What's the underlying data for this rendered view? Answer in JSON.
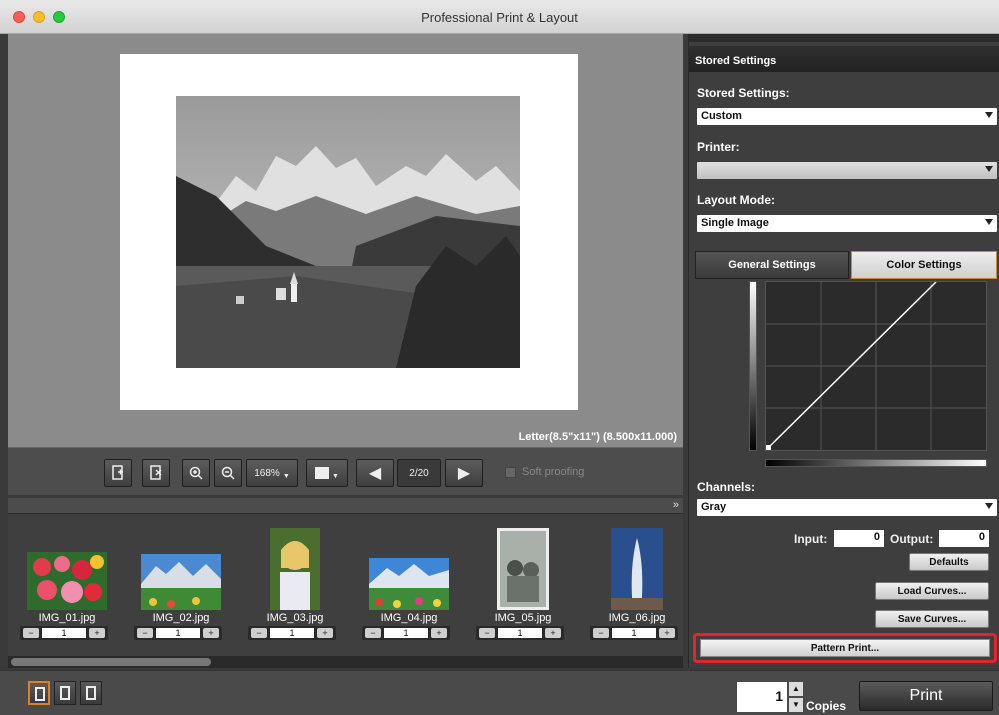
{
  "window": {
    "title": "Professional Print & Layout"
  },
  "preview": {
    "paper_size": "Letter(8.5\"x11\") (8.500x11.000)"
  },
  "toolbar": {
    "zoom": "168%",
    "page_indicator": "2/20",
    "soft_proofing_label": "Soft proofing"
  },
  "thumbnails": [
    {
      "filename": "IMG_01.jpg",
      "copies": "1"
    },
    {
      "filename": "IMG_02.jpg",
      "copies": "1"
    },
    {
      "filename": "IMG_03.jpg",
      "copies": "1"
    },
    {
      "filename": "IMG_04.jpg",
      "copies": "1"
    },
    {
      "filename": "IMG_05.jpg",
      "copies": "1"
    },
    {
      "filename": "IMG_06.jpg",
      "copies": "1"
    }
  ],
  "panel": {
    "section_title": "Stored Settings",
    "stored_settings_label": "Stored Settings:",
    "stored_settings_value": "Custom",
    "printer_label": "Printer:",
    "layout_mode_label": "Layout Mode:",
    "layout_mode_value": "Single Image",
    "tabs": [
      "General Settings",
      "Color Settings"
    ],
    "channels_label": "Channels:",
    "channels_value": "Gray",
    "input_label": "Input:",
    "input_value": "0",
    "output_label": "Output:",
    "output_value": "0",
    "defaults_button": "Defaults",
    "load_curves_button": "Load Curves...",
    "save_curves_button": "Save Curves...",
    "pattern_print_button": "Pattern Print..."
  },
  "bottom": {
    "copies_value": "1",
    "copies_label": "Copies",
    "print_button": "Print"
  }
}
